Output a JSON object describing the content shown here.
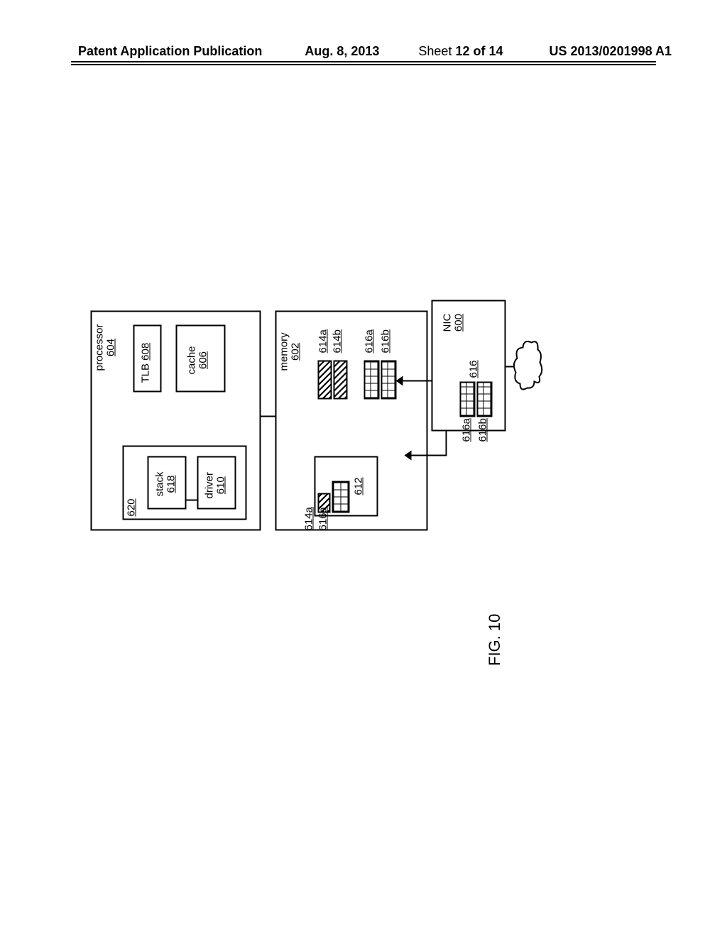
{
  "header": {
    "publication": "Patent Application Publication",
    "date": "Aug. 8, 2013",
    "sheet_prefix": "Sheet ",
    "sheet_num": "12 of 14",
    "docnum": "US 2013/0201998 A1"
  },
  "figure_caption": "FIG. 10",
  "blocks": {
    "processor": {
      "label": "processor",
      "num": "604"
    },
    "tlb": {
      "label": "TLB ",
      "num": "608"
    },
    "cache": {
      "label": "cache",
      "num": "606"
    },
    "stack": {
      "label": "stack",
      "num": "618"
    },
    "driver": {
      "label": "driver",
      "num": "610"
    },
    "g620": {
      "num": "620"
    },
    "memory": {
      "label": "memory",
      "num": "602"
    },
    "g612": {
      "num": "612"
    },
    "g614a": {
      "num": "614a"
    },
    "g614b": {
      "num": "614b"
    },
    "g616a": {
      "num": "616a"
    },
    "g616b": {
      "num": "616b"
    },
    "g616": {
      "num": "616"
    },
    "nic": {
      "label": "NIC",
      "num": "600"
    }
  }
}
